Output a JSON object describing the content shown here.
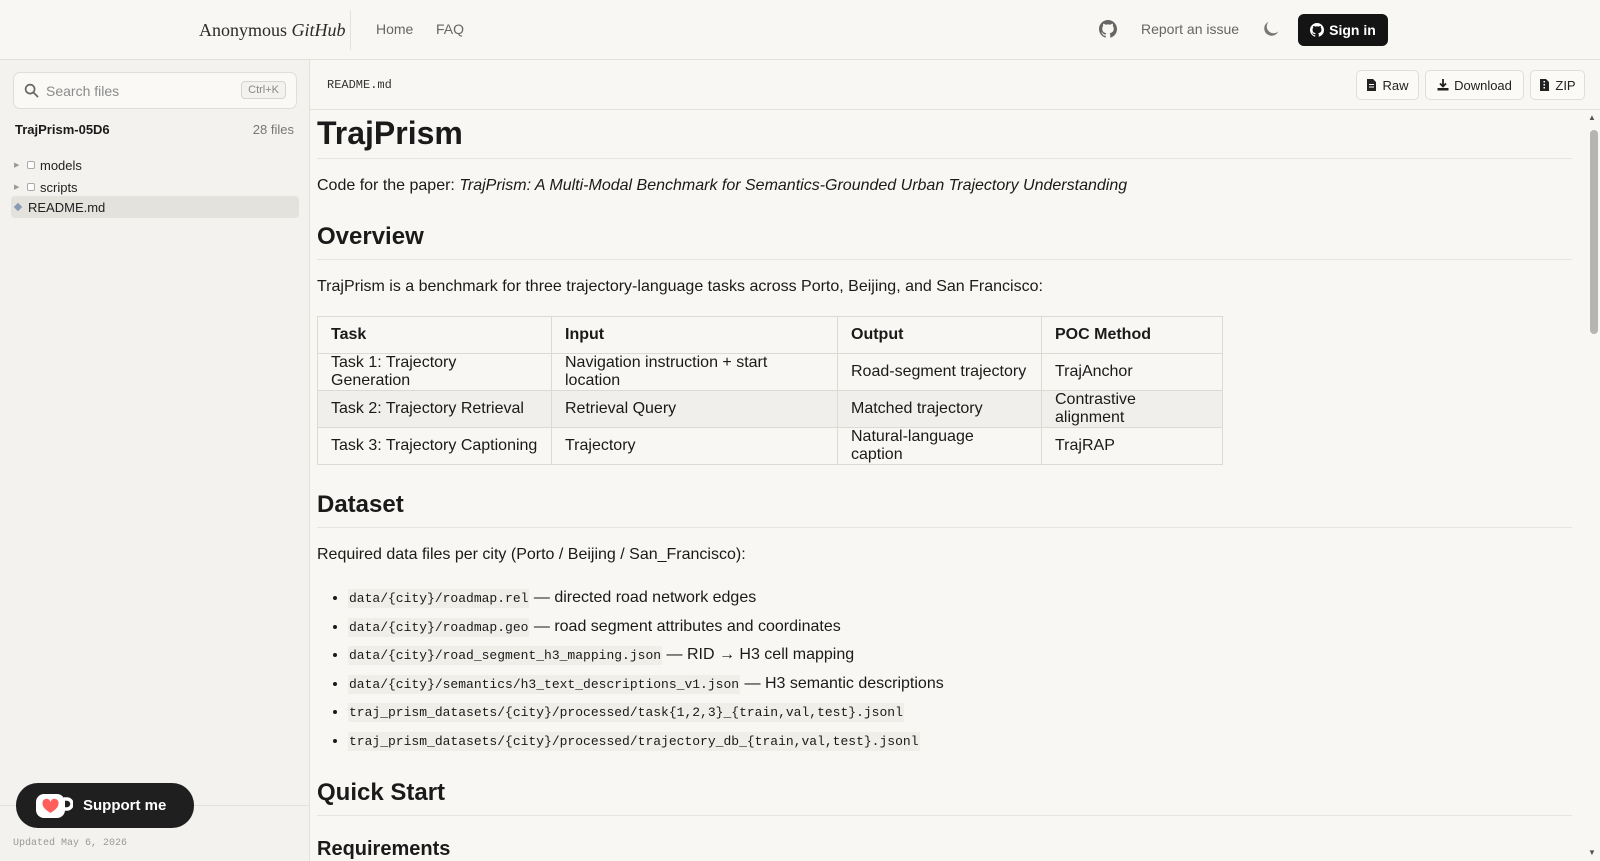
{
  "header": {
    "brand_prefix": "Anonymous",
    "brand_suffix": "GitHub",
    "nav": [
      "Home",
      "FAQ"
    ],
    "report_label": "Report an issue",
    "signin_label": "Sign in"
  },
  "sidebar": {
    "search_placeholder": "Search files",
    "search_shortcut": "Ctrl+K",
    "repo_name": "TrajPrism-05D6",
    "file_count": "28 files",
    "items": [
      {
        "label": "models",
        "type": "folder"
      },
      {
        "label": "scripts",
        "type": "folder"
      },
      {
        "label": "README.md",
        "type": "file",
        "active": true
      }
    ],
    "updated": "Updated May 6, 2026",
    "support_label": "Support me"
  },
  "filebar": {
    "filename": "README.md",
    "raw_label": "Raw",
    "download_label": "Download",
    "zip_label": "ZIP"
  },
  "readme": {
    "title": "TrajPrism",
    "intro_prefix": "Code for the paper: ",
    "intro_title": "TrajPrism: A Multi-Modal Benchmark for Semantics-Grounded Urban Trajectory Understanding",
    "overview_heading": "Overview",
    "overview_text": "TrajPrism is a benchmark for three trajectory-language tasks across Porto, Beijing, and San Francisco:",
    "table": {
      "headers": [
        "Task",
        "Input",
        "Output",
        "POC Method"
      ],
      "rows": [
        [
          "Task 1: Trajectory Generation",
          "Navigation instruction + start location",
          "Road-segment trajectory",
          "TrajAnchor"
        ],
        [
          "Task 2: Trajectory Retrieval",
          "Retrieval Query",
          "Matched trajectory",
          "Contrastive alignment"
        ],
        [
          "Task 3: Trajectory Captioning",
          "Trajectory",
          "Natural-language caption",
          "TrajRAP"
        ]
      ]
    },
    "dataset_heading": "Dataset",
    "dataset_text": "Required data files per city (Porto / Beijing / San_Francisco):",
    "dataset_items": [
      {
        "code": "data/{city}/roadmap.rel",
        "desc": " — directed road network edges"
      },
      {
        "code": "data/{city}/roadmap.geo",
        "desc": " — road segment attributes and coordinates"
      },
      {
        "code": "data/{city}/road_segment_h3_mapping.json",
        "desc": " — RID → H3 cell mapping"
      },
      {
        "code": "data/{city}/semantics/h3_text_descriptions_v1.json",
        "desc": " — H3 semantic descriptions"
      },
      {
        "code": "traj_prism_datasets/{city}/processed/task{1,2,3}_{train,val,test}.jsonl",
        "desc": ""
      },
      {
        "code": "traj_prism_datasets/{city}/processed/trajectory_db_{train,val,test}.jsonl",
        "desc": ""
      }
    ],
    "quickstart_heading": "Quick Start",
    "requirements_heading": "Requirements"
  }
}
